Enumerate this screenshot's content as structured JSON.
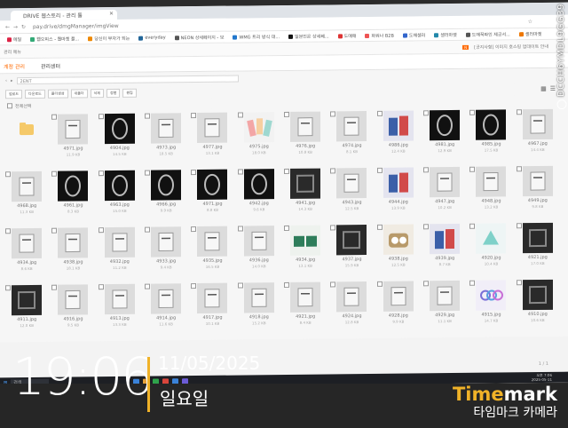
{
  "browser": {
    "tab_title": "DRIVE 웹스토리 - 관리 툴",
    "url": "pay.drive/dmgManager/imgView",
    "bookmarks": [
      "메일",
      "웹오피스 - 웹마켓 플...",
      "당신이 부자가 되는",
      "everyday",
      "NEON 상세페이지 - 보",
      "WMG 트리 방식 대...",
      "일본인은 상세페...",
      "도매매",
      "파워나 B2B",
      "도매셀러",
      "셀러마켓",
      "도매꾹파인 제공서...",
      "셀러마켓"
    ]
  },
  "site": {
    "header_left": "관리 메뉴",
    "banner_text": "[공지사항] 이미지 호스팅 업데이트 안내",
    "menus": [
      "계정 관리",
      "관리센터"
    ],
    "breadcrumb": "2ENT",
    "toolbar": [
      "업로드",
      "다운로드",
      "폴더생성",
      "새폴더",
      "삭제",
      "정렬",
      "편집"
    ],
    "select_all": "전체선택",
    "pagination": "1 / 1"
  },
  "files": [
    {
      "name": "",
      "size": ""
    },
    {
      "name": "4971.jpg",
      "size": "11.9 KB"
    },
    {
      "name": "4904.jpg",
      "size": "14.5 KB"
    },
    {
      "name": "4973.jpg",
      "size": "18.5 KB"
    },
    {
      "name": "4977.jpg",
      "size": "13.1 KB"
    },
    {
      "name": "4975.jpg",
      "size": "18.0 KB"
    },
    {
      "name": "4976.jpg",
      "size": "10.8 KB"
    },
    {
      "name": "4974.jpg",
      "size": "8.1 KB"
    },
    {
      "name": "4986.jpg",
      "size": "12.4 KB"
    },
    {
      "name": "4981.jpg",
      "size": "12.9 KB"
    },
    {
      "name": "4985.jpg",
      "size": "17.5 KB"
    },
    {
      "name": "4967.jpg",
      "size": "14.4 KB"
    },
    {
      "name": "4968.jpg",
      "size": "11.3 KB"
    },
    {
      "name": "4961.jpg",
      "size": "8.3 KB"
    },
    {
      "name": "4963.jpg",
      "size": "15.0 KB"
    },
    {
      "name": "4966.jpg",
      "size": "9.9 KB"
    },
    {
      "name": "4971.jpg",
      "size": "8.8 KB"
    },
    {
      "name": "4942.jpg",
      "size": "9.6 KB"
    },
    {
      "name": "4941.jpg",
      "size": "14.3 KB"
    },
    {
      "name": "4943.jpg",
      "size": "12.5 KB"
    },
    {
      "name": "4944.jpg",
      "size": "13.9 KB"
    },
    {
      "name": "4947.jpg",
      "size": "10.2 KB"
    },
    {
      "name": "4948.jpg",
      "size": "13.2 KB"
    },
    {
      "name": "4949.jpg",
      "size": "9.8 KB"
    },
    {
      "name": "4934.jpg",
      "size": "8.6 KB"
    },
    {
      "name": "4938.jpg",
      "size": "18.1 KB"
    },
    {
      "name": "4932.jpg",
      "size": "11.2 KB"
    },
    {
      "name": "4933.jpg",
      "size": "9.4 KB"
    },
    {
      "name": "4935.jpg",
      "size": "16.5 KB"
    },
    {
      "name": "4936.jpg",
      "size": "14.0 KB"
    },
    {
      "name": "4934.jpg",
      "size": "13.1 KB"
    },
    {
      "name": "4937.jpg",
      "size": "15.9 KB"
    },
    {
      "name": "4938.jpg",
      "size": "12.5 KB"
    },
    {
      "name": "4939.jpg",
      "size": "8.7 KB"
    },
    {
      "name": "4920.jpg",
      "size": "10.4 KB"
    },
    {
      "name": "4921.jpg",
      "size": "17.0 KB"
    },
    {
      "name": "4911.jpg",
      "size": "12.0 KB"
    },
    {
      "name": "4916.jpg",
      "size": "9.5 KB"
    },
    {
      "name": "4913.jpg",
      "size": "13.3 KB"
    },
    {
      "name": "4914.jpg",
      "size": "11.6 KB"
    },
    {
      "name": "4917.jpg",
      "size": "10.1 KB"
    },
    {
      "name": "4918.jpg",
      "size": "15.2 KB"
    },
    {
      "name": "4921.jpg",
      "size": "8.4 KB"
    },
    {
      "name": "4924.jpg",
      "size": "12.8 KB"
    },
    {
      "name": "4928.jpg",
      "size": "9.9 KB"
    },
    {
      "name": "4929.jpg",
      "size": "11.1 KB"
    },
    {
      "name": "4915.jpg",
      "size": "14.7 KB"
    },
    {
      "name": "4910.jpg",
      "size": "10.6 KB"
    }
  ],
  "taskbar": {
    "search": "검색",
    "time": "오후 7:06",
    "date": "2025-05-11"
  },
  "watermark": {
    "time": "19:06",
    "date": "11/05/2025",
    "day": "일요일",
    "brand_time": "Time",
    "brand_mark": "mark",
    "brand_sub": "타임마크 카메라",
    "code": "DCCH6YMDL9GG39"
  }
}
